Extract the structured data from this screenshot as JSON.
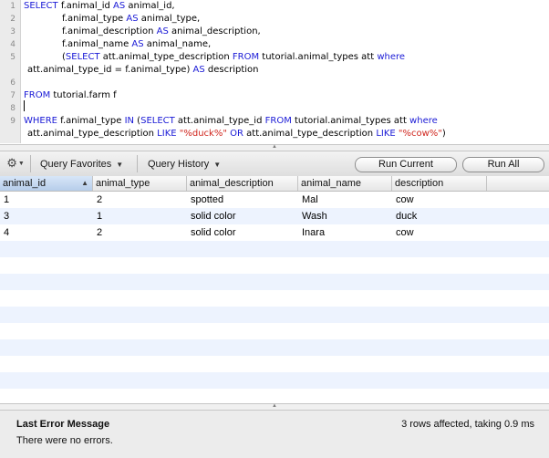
{
  "editor": {
    "line_numbers": [
      "1",
      "2",
      "3",
      "4",
      "5",
      "6",
      "7",
      "8",
      "9"
    ],
    "lines": [
      [
        [
          "kw",
          "SELECT"
        ],
        [
          "txt",
          " f.animal_id "
        ],
        [
          "kw",
          "AS"
        ],
        [
          "txt",
          " animal_id,"
        ]
      ],
      [
        [
          "txt",
          "f.animal_type "
        ],
        [
          "kw",
          "AS"
        ],
        [
          "txt",
          " animal_type,"
        ]
      ],
      [
        [
          "txt",
          "f.animal_description "
        ],
        [
          "kw",
          "AS"
        ],
        [
          "txt",
          " animal_description,"
        ]
      ],
      [
        [
          "txt",
          "f.animal_name "
        ],
        [
          "kw",
          "AS"
        ],
        [
          "txt",
          " animal_name,"
        ]
      ],
      [
        [
          "txt",
          "("
        ],
        [
          "kw",
          "SELECT"
        ],
        [
          "txt",
          " att.animal_type_description "
        ],
        [
          "kw",
          "FROM"
        ],
        [
          "txt",
          " tutorial.animal_types att "
        ],
        [
          "kw",
          "where"
        ]
      ],
      [
        [
          "txt",
          "att.animal_type_id = f.animal_type) "
        ],
        [
          "kw",
          "AS"
        ],
        [
          "txt",
          " description"
        ]
      ],
      [],
      [
        [
          "kw",
          "FROM"
        ],
        [
          "txt",
          " tutorial.farm f"
        ]
      ],
      [],
      [
        [
          "kw",
          "WHERE"
        ],
        [
          "txt",
          " f.animal_type "
        ],
        [
          "kw",
          "IN"
        ],
        [
          "txt",
          " ("
        ],
        [
          "kw",
          "SELECT"
        ],
        [
          "txt",
          " att.animal_type_id "
        ],
        [
          "kw",
          "FROM"
        ],
        [
          "txt",
          " tutorial.animal_types att "
        ],
        [
          "kw",
          "where"
        ]
      ],
      [
        [
          "txt",
          "att.animal_type_description "
        ],
        [
          "kw",
          "LIKE"
        ],
        [
          "txt",
          " "
        ],
        [
          "str",
          "\"%duck%\""
        ],
        [
          "txt",
          " "
        ],
        [
          "kw",
          "OR"
        ],
        [
          "txt",
          " att.animal_type_description "
        ],
        [
          "kw",
          "LIKE"
        ],
        [
          "txt",
          " "
        ],
        [
          "str",
          "\"%cow%\""
        ],
        [
          "txt",
          ")"
        ]
      ]
    ]
  },
  "toolbar": {
    "gear_icon": "gear-icon",
    "query_favorites": "Query Favorites",
    "query_history": "Query History",
    "run_current": "Run Current",
    "run_all": "Run All"
  },
  "grid": {
    "columns": [
      "animal_id",
      "animal_type",
      "animal_description",
      "animal_name",
      "description"
    ],
    "sorted_column": "animal_id",
    "rows": [
      [
        "1",
        "2",
        "spotted",
        "Mal",
        "cow"
      ],
      [
        "3",
        "1",
        "solid color",
        "Wash",
        "duck"
      ],
      [
        "4",
        "2",
        "solid color",
        "Inara",
        "cow"
      ]
    ],
    "stripe_color": "#edf3fe"
  },
  "status": {
    "error_title": "Last Error Message",
    "error_text": "There were no errors.",
    "info": "3 rows affected, taking 0.9 ms"
  },
  "colors": {
    "keyword": "#1a1ad6",
    "string": "#d0261e"
  }
}
